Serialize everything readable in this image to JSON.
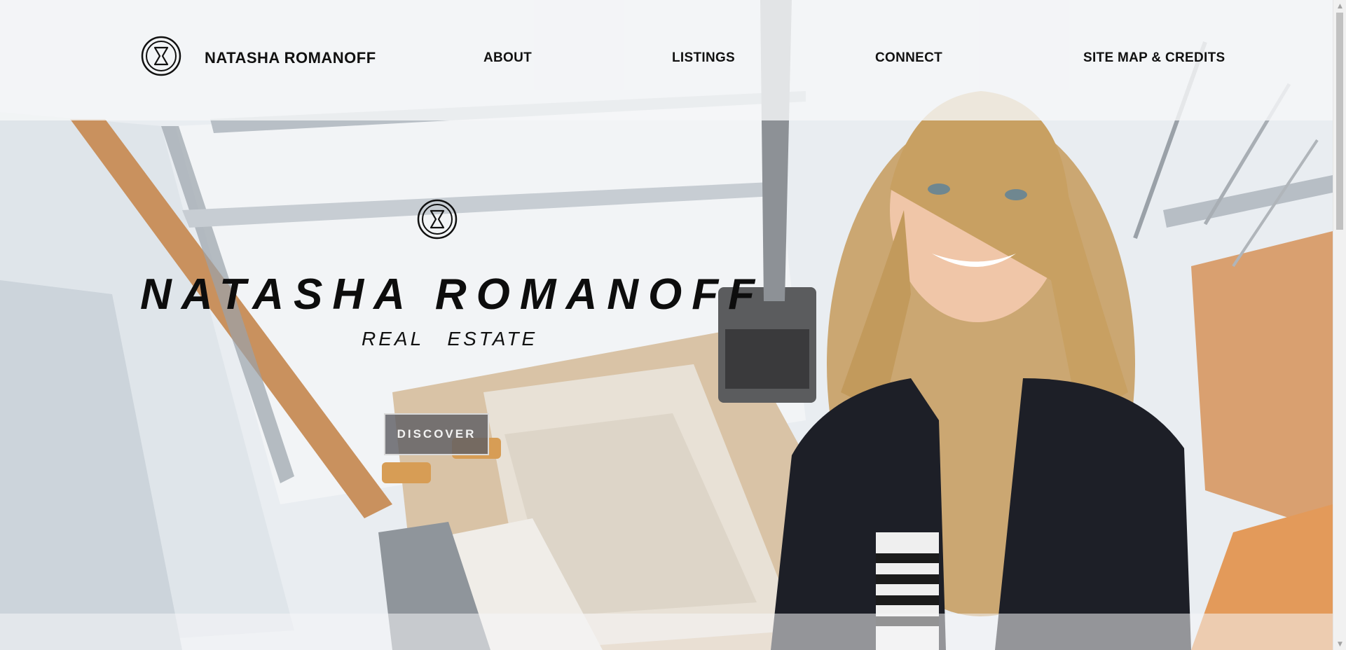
{
  "header": {
    "brand_name": "NATASHA ROMANOFF",
    "logo_icon": "hourglass-emblem-icon",
    "nav": [
      {
        "label": "ABOUT"
      },
      {
        "label": "LISTINGS"
      },
      {
        "label": "CONNECT"
      },
      {
        "label": "SITE MAP & CREDITS"
      }
    ]
  },
  "hero": {
    "title": "NATASHA ROMANOFF",
    "subtitle": "REAL ESTATE",
    "cta_label": "DISCOVER",
    "emblem_icon": "hourglass-emblem-icon",
    "background_image": "glass-cabin-snow-interior-photo",
    "portrait_image": "agent-portrait-photo"
  },
  "colors": {
    "header_bg": "#f5f6f8",
    "text": "#111111",
    "button_bg": "#5f5f64",
    "button_border": "#d9d9d9",
    "button_text": "#f2f2f2"
  }
}
